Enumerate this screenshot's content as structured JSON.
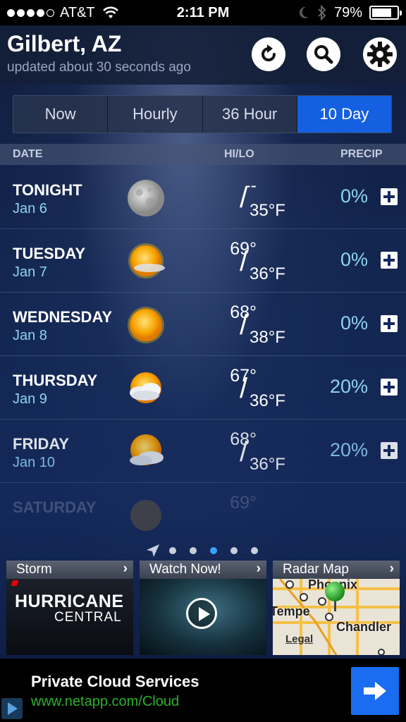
{
  "status_bar": {
    "carrier": "AT&T",
    "time": "2:11 PM",
    "battery": "79%",
    "battery_level": 0.79,
    "signal_bars_filled": 4,
    "signal_bars_total": 5
  },
  "header": {
    "city": "Gilbert, AZ",
    "updated": "updated about 30 seconds ago",
    "icons": [
      "refresh-icon",
      "search-icon",
      "gear-icon"
    ]
  },
  "tabs": [
    {
      "label": "Now",
      "active": false
    },
    {
      "label": "Hourly",
      "active": false
    },
    {
      "label": "36 Hour",
      "active": false
    },
    {
      "label": "10 Day",
      "active": true
    }
  ],
  "columns": {
    "date": "DATE",
    "hilo": "HI/LO",
    "precip": "PRECIP"
  },
  "forecast": [
    {
      "day": "TONIGHT",
      "date": "Jan 6",
      "hi": "--",
      "lo": "35°F",
      "precip": "0%",
      "icon": "moon-icon"
    },
    {
      "day": "TUESDAY",
      "date": "Jan 7",
      "hi": "69°",
      "lo": "36°F",
      "precip": "0%",
      "icon": "sun-haze-icon"
    },
    {
      "day": "WEDNESDAY",
      "date": "Jan 8",
      "hi": "68°",
      "lo": "38°F",
      "precip": "0%",
      "icon": "sun-icon"
    },
    {
      "day": "THURSDAY",
      "date": "Jan 9",
      "hi": "67°",
      "lo": "36°F",
      "precip": "20%",
      "icon": "partly-cloudy-icon"
    },
    {
      "day": "FRIDAY",
      "date": "Jan 10",
      "hi": "68°",
      "lo": "36°F",
      "precip": "20%",
      "icon": "partly-cloudy-icon"
    },
    {
      "day": "SATURDAY",
      "hi": "69°",
      "icon": "partly-cloudy-icon"
    }
  ],
  "pager": {
    "pages": 5,
    "active_index": 2
  },
  "cards": {
    "storm": {
      "title": "Storm",
      "line1": "HURRICANE",
      "line2": "CENTRAL"
    },
    "watch": {
      "title": "Watch Now!"
    },
    "radar": {
      "title": "Radar Map",
      "labels": [
        "Phoenix",
        "Tempe",
        "Chandler",
        "Legal"
      ]
    }
  },
  "ad": {
    "title": "Private Cloud Services",
    "url": "www.netapp.com/Cloud"
  },
  "colors": {
    "accent": "#1560e0",
    "precip": "#8fd3f0",
    "ad_url": "#2bb02b"
  }
}
